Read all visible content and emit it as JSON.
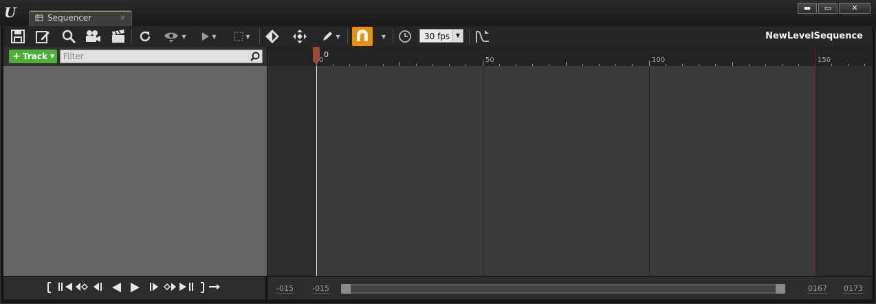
{
  "window": {
    "tab_title": "Sequencer",
    "tab_close": "×",
    "minimize": "▬",
    "restore": "▭",
    "close": "✕",
    "logo_text": "U"
  },
  "toolbar": {
    "icons": [
      "save-icon",
      "save-as-icon",
      "find-icon",
      "camera-icon",
      "render-movie-icon",
      "restore-icon",
      "show-icon",
      "play-options-icon",
      "selection-icon",
      "key-icon",
      "add-key-icon",
      "edit-tool-icon",
      "snap-icon",
      "snap-options-icon",
      "time-icon",
      "framerate",
      "curve-editor-icon"
    ],
    "framerate": "30 fps",
    "sequence_name": "NewLevelSequence",
    "snap_color": "#e8900c"
  },
  "tracks": {
    "add_label": "Track",
    "plus": "+",
    "filter_placeholder": "Filter"
  },
  "ruler": {
    "labels": [
      "0",
      "50",
      "100",
      "150"
    ],
    "current_frame": "0"
  },
  "transport": {
    "buttons": [
      "set-start-icon",
      "jump-start-icon",
      "prev-key-icon",
      "step-back-icon",
      "play-reverse-icon",
      "play-icon",
      "step-forward-icon",
      "next-key-icon",
      "jump-end-icon",
      "set-end-icon",
      "loop-icon"
    ]
  },
  "range": {
    "view_start": "-015",
    "work_start": "-015",
    "work_end": "0167",
    "view_end": "0173"
  }
}
